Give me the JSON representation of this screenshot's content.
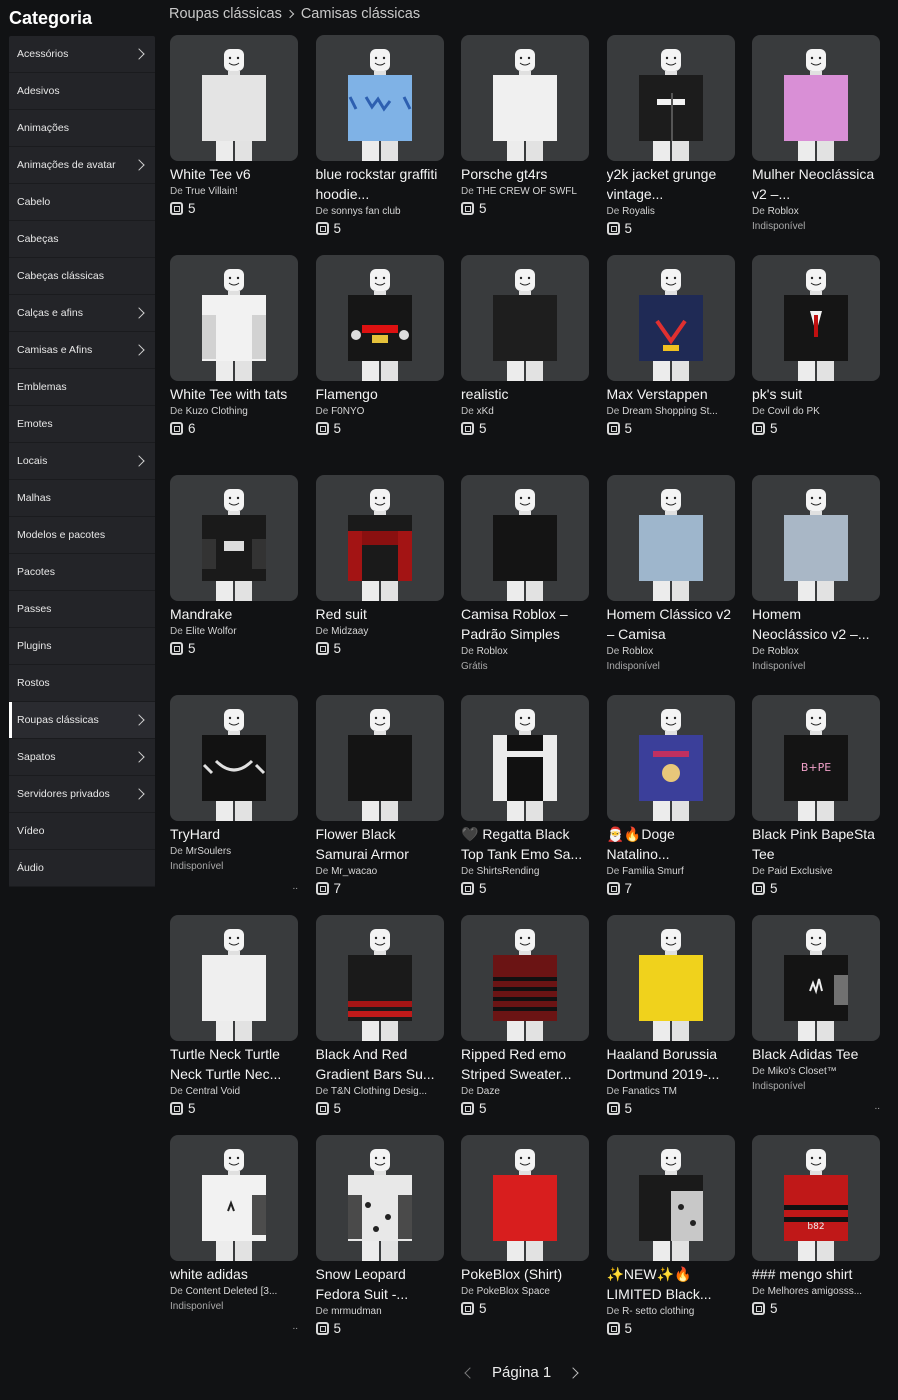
{
  "sidebar": {
    "title": "Categoria",
    "items": [
      {
        "label": "Acessórios",
        "chevron": true
      },
      {
        "label": "Adesivos",
        "chevron": false
      },
      {
        "label": "Animações",
        "chevron": false
      },
      {
        "label": "Animações de avatar",
        "chevron": true
      },
      {
        "label": "Cabelo",
        "chevron": false
      },
      {
        "label": "Cabeças",
        "chevron": false
      },
      {
        "label": "Cabeças clássicas",
        "chevron": false
      },
      {
        "label": "Calças e afins",
        "chevron": true
      },
      {
        "label": "Camisas e Afins",
        "chevron": true
      },
      {
        "label": "Emblemas",
        "chevron": false
      },
      {
        "label": "Emotes",
        "chevron": false
      },
      {
        "label": "Locais",
        "chevron": true
      },
      {
        "label": "Malhas",
        "chevron": false
      },
      {
        "label": "Modelos e pacotes",
        "chevron": false
      },
      {
        "label": "Pacotes",
        "chevron": false
      },
      {
        "label": "Passes",
        "chevron": false
      },
      {
        "label": "Plugins",
        "chevron": false
      },
      {
        "label": "Rostos",
        "chevron": false
      },
      {
        "label": "Roupas clássicas",
        "chevron": true,
        "active": true
      },
      {
        "label": "Sapatos",
        "chevron": true
      },
      {
        "label": "Servidores privados",
        "chevron": true
      },
      {
        "label": "Vídeo",
        "chevron": false
      },
      {
        "label": "Áudio",
        "chevron": false
      }
    ]
  },
  "breadcrumb": {
    "parent": "Roupas clássicas",
    "current": "Camisas clássicas"
  },
  "by_prefix": "De",
  "items": [
    {
      "name": "White Tee v6",
      "creator": "True Villain!",
      "price": "5",
      "color": "#e4e4e4",
      "pattern": "plain"
    },
    {
      "name": "blue rockstar graffiti hoodie...",
      "creator": "sonnys fan club",
      "price": "5",
      "color": "#7fb2e6",
      "pattern": "graffiti"
    },
    {
      "name": "Porsche gt4rs",
      "creator": "THE CREW OF SWFL",
      "price": "5",
      "color": "#f0f0f0",
      "pattern": "plain"
    },
    {
      "name": "y2k jacket grunge vintage...",
      "creator": "Royalis",
      "price": "5",
      "color": "#1c1c1c",
      "pattern": "jacket"
    },
    {
      "name": "Mulher Neoclássica v2 –...",
      "creator": "Roblox",
      "status": "Indisponível",
      "color": "#d98fd6",
      "pattern": "plain"
    },
    {
      "name": "White Tee with tats",
      "creator": "Kuzo Clothing",
      "price": "6",
      "color": "#f2f2f2",
      "pattern": "tats"
    },
    {
      "name": "Flamengo",
      "creator": "F0NYO",
      "price": "5",
      "color": "#161616",
      "pattern": "flamengo"
    },
    {
      "name": "realistic",
      "creator": "xKd",
      "price": "5",
      "color": "#1e1e1e",
      "pattern": "plain"
    },
    {
      "name": "Max Verstappen",
      "creator": "Dream Shopping St...",
      "price": "5",
      "color": "#1f2a55",
      "pattern": "racing"
    },
    {
      "name": "pk's suit",
      "creator": "Covil do PK",
      "price": "5",
      "color": "#151515",
      "pattern": "suit"
    },
    {
      "name": "Mandrake",
      "creator": "Elite Wolfor",
      "price": "5",
      "color": "#1a1a1a",
      "pattern": "mandrake"
    },
    {
      "name": "Red suit",
      "creator": "Midzaay",
      "price": "5",
      "color": "#1a1a1a",
      "pattern": "redsuit"
    },
    {
      "name": "Camisa Roblox – Padrão Simples",
      "creator": "Roblox",
      "status": "Grátis",
      "color": "#141414",
      "pattern": "plain"
    },
    {
      "name": "Homem Clássico v2 – Camisa",
      "creator": "Roblox",
      "status": "Indisponível",
      "color": "#9eb6cc",
      "pattern": "plain"
    },
    {
      "name": "Homem Neoclássico v2 –...",
      "creator": "Roblox",
      "status": "Indisponível",
      "color": "#a9b7c6",
      "pattern": "plain"
    },
    {
      "name": "TryHard",
      "creator": "MrSoulers",
      "status": "Indisponível",
      "color": "#121212",
      "pattern": "tryhard",
      "more": ".."
    },
    {
      "name": "Flower Black Samurai Armor",
      "creator": "Mr_wacao",
      "price": "7",
      "color": "#141414",
      "pattern": "plain"
    },
    {
      "name": "🖤 Regatta Black Top Tank Emo Sa...",
      "creator": "ShirtsRending",
      "price": "5",
      "color": "#111111",
      "pattern": "tank"
    },
    {
      "name": "🎅🔥Doge Natalino...",
      "creator": "Familia Smurf",
      "price": "7",
      "color": "#3b3f9a",
      "pattern": "doge"
    },
    {
      "name": "Black Pink BapeSta Tee",
      "creator": "Paid Exclusive",
      "price": "5",
      "color": "#141414",
      "pattern": "bape"
    },
    {
      "name": "Turtle Neck Turtle Neck Turtle Nec...",
      "creator": "Central Void",
      "price": "5",
      "color": "#efefef",
      "pattern": "plain"
    },
    {
      "name": "Black And Red Gradient Bars Su...",
      "creator": "T&N Clothing Desig...",
      "price": "5",
      "color": "#1a1a1a",
      "pattern": "redbars"
    },
    {
      "name": "Ripped Red emo Striped Sweater...",
      "creator": "Daze",
      "price": "5",
      "color": "#6b1414",
      "pattern": "stripes"
    },
    {
      "name": "Haaland Borussia Dortmund 2019-...",
      "creator": "Fanatics TM",
      "price": "5",
      "color": "#f0d21c",
      "pattern": "plain"
    },
    {
      "name": "Black Adidas Tee",
      "creator": "Miko's Closet™",
      "status": "Indisponível",
      "color": "#141414",
      "pattern": "adidas",
      "more": ".."
    },
    {
      "name": "white adidas",
      "creator": "Content Deleted [3...",
      "status": "Indisponível",
      "color": "#f2f2f2",
      "pattern": "whiteadidas",
      "more": ".."
    },
    {
      "name": "Snow Leopard Fedora Suit -...",
      "creator": "mrmudman",
      "price": "5",
      "color": "#e8e8e8",
      "pattern": "leopard"
    },
    {
      "name": "PokeBlox (Shirt)",
      "creator": "PokeBlox Space",
      "price": "5",
      "color": "#d81e1e",
      "pattern": "plain"
    },
    {
      "name": "✨NEW✨🔥 LIMITED Black...",
      "creator": "R- setto clothing",
      "price": "5",
      "color": "#1a1a1a",
      "pattern": "limited"
    },
    {
      "name": "### mengo shirt",
      "creator": "Melhores amigosss...",
      "price": "5",
      "color": "#c01818",
      "pattern": "mengo"
    }
  ],
  "pagination": {
    "label": "Página 1"
  }
}
